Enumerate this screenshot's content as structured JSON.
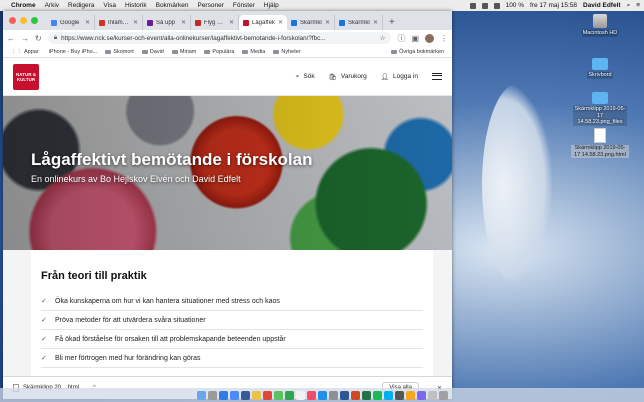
{
  "menubar": {
    "app": "Chrome",
    "items": [
      "Arkiv",
      "Redigera",
      "Visa",
      "Historik",
      "Bokmärken",
      "Personer",
      "Fönster",
      "Hjälp"
    ],
    "battery": "100 %",
    "clock": "fre 17 maj  15:58",
    "user": "David Edfelt"
  },
  "tabs": [
    {
      "label": "Google",
      "color": "#4285f4"
    },
    {
      "label": "Inlämning",
      "color": "#d93025"
    },
    {
      "label": "Så upp",
      "color": "#6a1b9a"
    },
    {
      "label": "Flyg Hi...",
      "color": "#c62828"
    },
    {
      "label": "Lågaffek",
      "color": "#c8102e",
      "active": true
    },
    {
      "label": "Skärmkl",
      "color": "#1a73e8"
    },
    {
      "label": "Skärmkl",
      "color": "#1a73e8"
    }
  ],
  "url": "https://www.nck.se/kurser-och-event/alla-onlinekurser/lagaffektivt-bemotande-i-forskolan/?fbc...",
  "bookmarks": [
    "Appar",
    "iPhone - Buy iPho...",
    "Skomort",
    "David",
    "Miriam",
    "Populära",
    "Media",
    "Nyheter"
  ],
  "bookmarks_end": "Övriga bokmärken",
  "site": {
    "logo": "NATUR & KULTUR",
    "nav": {
      "search": "Sök",
      "cart": "Varukorg",
      "login": "Logga in"
    }
  },
  "hero": {
    "title": "Lågaffektivt bemötande i förskolan",
    "subtitle": "En onlinekurs av Bo Hejlskov Elvén och David Edfelt"
  },
  "card": {
    "heading": "Från teori till praktik",
    "items": [
      "Öka kunskaperna om hur vi kan hantera situationer med stress och kaos",
      "Pröva metoder för att utvärdera svåra situationer",
      "Få ökad förståelse för orsaken till att problemskapande beteenden uppstår",
      "Bli mer förtrogen med hur förändring kan göras"
    ]
  },
  "download": {
    "file": "Skärmklipp 20....html",
    "show_all": "Visa alla"
  },
  "desktop": [
    {
      "label": "Macintosh HD",
      "kind": "hdd"
    },
    {
      "label": "Skrivbord",
      "kind": "folder"
    },
    {
      "label": "Skärmklipp 2019-05-17 14.58.23.png_files",
      "kind": "folder"
    },
    {
      "label": "Skärmklipp 2019-05-17 14.58.23.png.html",
      "kind": "file"
    }
  ]
}
